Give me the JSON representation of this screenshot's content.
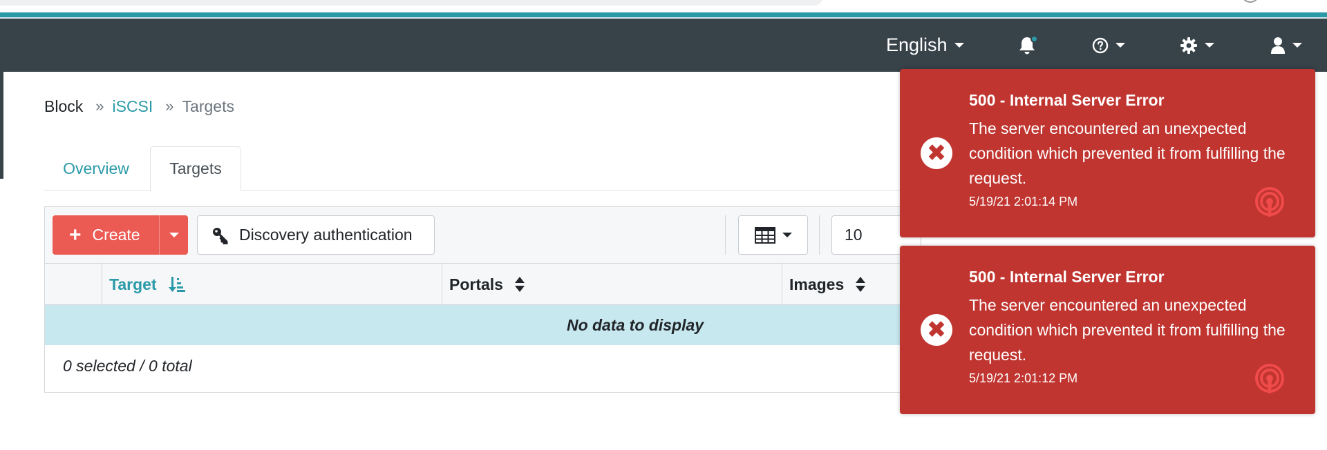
{
  "navbar": {
    "language": "English",
    "icons": {
      "bell": "bell-icon",
      "help": "question-circle-icon",
      "settings": "gear-icon",
      "user": "user-icon"
    }
  },
  "breadcrumb": {
    "items": [
      "Block",
      "iSCSI",
      "Targets"
    ]
  },
  "tabs": [
    {
      "label": "Overview",
      "active": false
    },
    {
      "label": "Targets",
      "active": true
    }
  ],
  "toolbar": {
    "create_label": "Create",
    "discovery_label": "Discovery authentication",
    "page_size": "10"
  },
  "table": {
    "columns": [
      "Target",
      "Portals",
      "Images"
    ],
    "sorted_column": "Target",
    "empty_message": "No data to display",
    "footer": "0 selected / 0 total"
  },
  "toasts": [
    {
      "title": "500 - Internal Server Error",
      "message": "The server encountered an unexpected condition which prevented it from fulfilling the request.",
      "time": "5/19/21 2:01:14 PM"
    },
    {
      "title": "500 - Internal Server Error",
      "message": "The server encountered an unexpected condition which prevented it from fulfilling the request.",
      "time": "5/19/21 2:01:12 PM"
    }
  ],
  "colors": {
    "navbar": "#374249",
    "accent": "#2b9aa8",
    "create_button": "#ec5a54",
    "toast_error": "#c03530",
    "empty_row": "#c7e8ef"
  }
}
